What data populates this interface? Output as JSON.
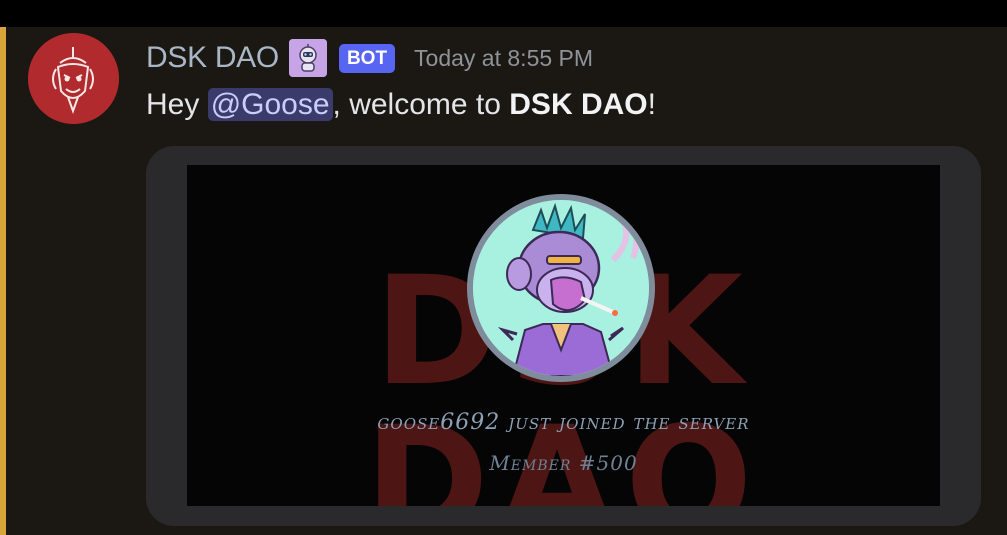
{
  "message": {
    "author": "DSK DAO",
    "bot_tag": "BOT",
    "timestamp": "Today at 8:55 PM",
    "content": {
      "prefix": "Hey ",
      "mention": "@Goose",
      "middle": ", welcome to ",
      "server": "DSK DAO",
      "suffix": "!"
    },
    "embed": {
      "background_word": "DSK DAO",
      "join_text": "goose6692 just joined the server",
      "member_text": "Member #500"
    },
    "colors": {
      "highlight_bar": "#d7a53a",
      "bot_tag": "#5865f2",
      "avatar": "#b12a2d"
    },
    "icons": {
      "avatar": "server-logo-icon",
      "role": "robot-role-icon"
    }
  }
}
